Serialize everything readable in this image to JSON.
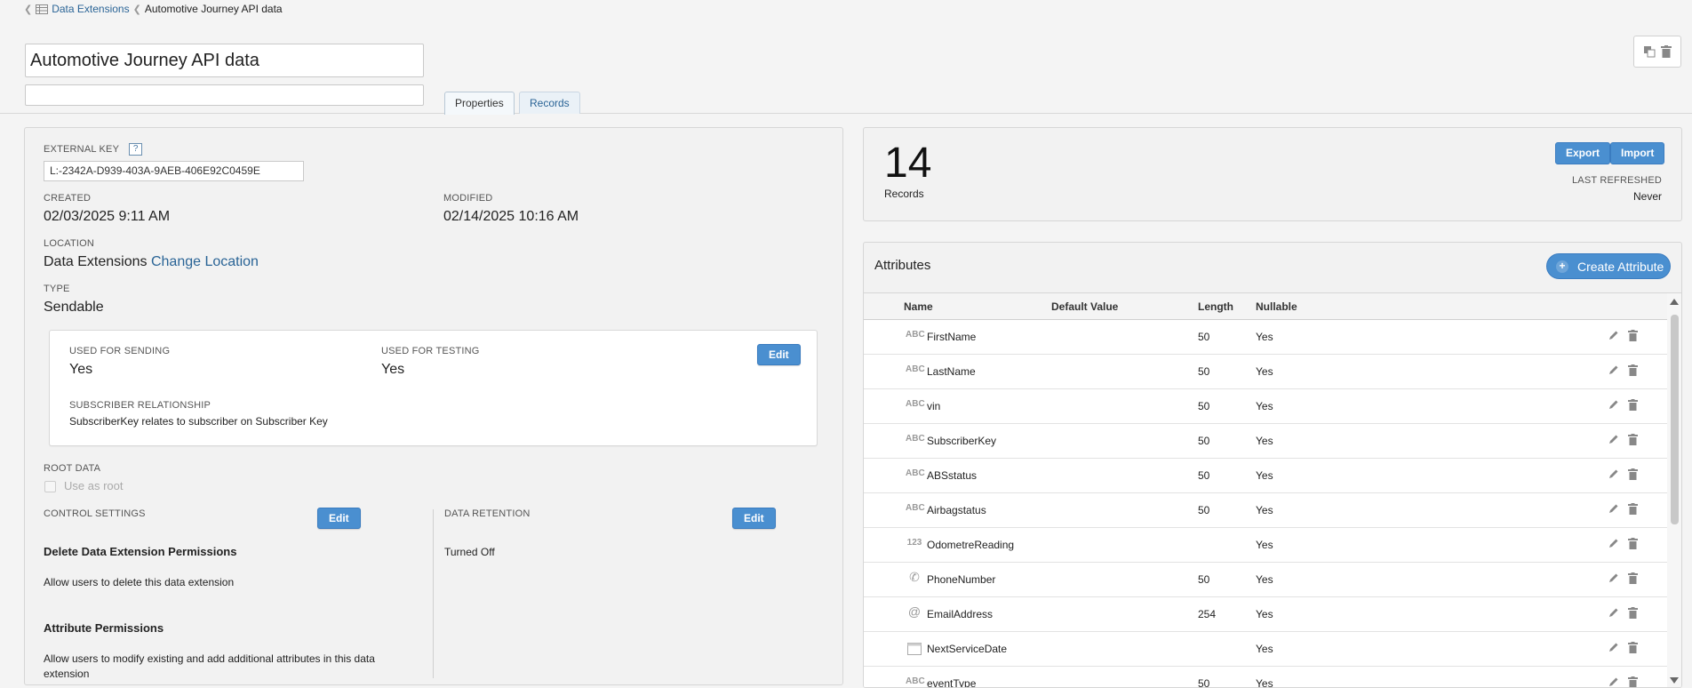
{
  "breadcrumb": {
    "parent": "Data Extensions",
    "current": "Automotive Journey API data"
  },
  "header": {
    "title_value": "Automotive Journey API data",
    "description_value": ""
  },
  "tabs": [
    {
      "label": "Properties",
      "active": true
    },
    {
      "label": "Records",
      "active": false
    }
  ],
  "properties": {
    "external_key_label": "EXTERNAL KEY",
    "help_glyph": "?",
    "external_key_value": "L:-2342A-D939-403A-9AEB-406E92C0459E",
    "created_label": "CREATED",
    "created_value": "02/03/2025 9:11 AM",
    "modified_label": "MODIFIED",
    "modified_value": "02/14/2025 10:16 AM",
    "location_label": "LOCATION",
    "location_value": "Data Extensions",
    "change_location": "Change Location",
    "type_label": "TYPE",
    "type_value": "Sendable",
    "sending": {
      "used_for_sending_label": "USED FOR SENDING",
      "used_for_sending_value": "Yes",
      "used_for_testing_label": "USED FOR TESTING",
      "used_for_testing_value": "Yes",
      "edit_label": "Edit",
      "relationship_label": "SUBSCRIBER RELATIONSHIP",
      "relationship_value": "SubscriberKey relates to subscriber on Subscriber Key"
    },
    "root_data_label": "ROOT DATA",
    "use_as_root_label": "Use as root",
    "control_settings_label": "CONTROL SETTINGS",
    "control_edit_label": "Edit",
    "delete_perm_title": "Delete Data Extension Permissions",
    "delete_perm_text": "Allow users to delete this data extension",
    "attr_perm_title": "Attribute Permissions",
    "attr_perm_text": "Allow users to modify existing and add additional attributes in this data extension",
    "data_retention_label": "DATA RETENTION",
    "retention_edit_label": "Edit",
    "retention_value": "Turned Off"
  },
  "stats": {
    "count": "14",
    "count_label": "Records",
    "export_label": "Export",
    "import_label": "Import",
    "last_refreshed_label": "LAST REFRESHED",
    "last_refreshed_value": "Never"
  },
  "attributes": {
    "title": "Attributes",
    "create_label": "Create Attribute",
    "columns": {
      "name": "Name",
      "default_value": "Default Value",
      "length": "Length",
      "nullable": "Nullable"
    },
    "rows": [
      {
        "type_icon": "text-type-icon",
        "type_glyph": "ABC",
        "name": "FirstName",
        "default": "",
        "length": "50",
        "nullable": "Yes"
      },
      {
        "type_icon": "text-type-icon",
        "type_glyph": "ABC",
        "name": "LastName",
        "default": "",
        "length": "50",
        "nullable": "Yes"
      },
      {
        "type_icon": "text-type-icon",
        "type_glyph": "ABC",
        "name": "vin",
        "default": "",
        "length": "50",
        "nullable": "Yes"
      },
      {
        "type_icon": "text-type-icon",
        "type_glyph": "ABC",
        "name": "SubscriberKey",
        "default": "",
        "length": "50",
        "nullable": "Yes"
      },
      {
        "type_icon": "text-type-icon",
        "type_glyph": "ABC",
        "name": "ABSstatus",
        "default": "",
        "length": "50",
        "nullable": "Yes"
      },
      {
        "type_icon": "text-type-icon",
        "type_glyph": "ABC",
        "name": "Airbagstatus",
        "default": "",
        "length": "50",
        "nullable": "Yes"
      },
      {
        "type_icon": "number-type-icon",
        "type_glyph": "123",
        "name": "OdometreReading",
        "default": "",
        "length": "",
        "nullable": "Yes"
      },
      {
        "type_icon": "phone-type-icon",
        "type_glyph": "✆",
        "name": "PhoneNumber",
        "default": "",
        "length": "50",
        "nullable": "Yes"
      },
      {
        "type_icon": "email-type-icon",
        "type_glyph": "@",
        "name": "EmailAddress",
        "default": "",
        "length": "254",
        "nullable": "Yes"
      },
      {
        "type_icon": "date-type-icon",
        "type_glyph": "",
        "name": "NextServiceDate",
        "default": "",
        "length": "",
        "nullable": "Yes"
      },
      {
        "type_icon": "text-type-icon",
        "type_glyph": "ABC",
        "name": "eventType",
        "default": "",
        "length": "50",
        "nullable": "Yes"
      }
    ]
  },
  "colors": {
    "accent": "#4a8fd0",
    "link": "#2a6496",
    "panel_bg": "#f2f2f2"
  }
}
